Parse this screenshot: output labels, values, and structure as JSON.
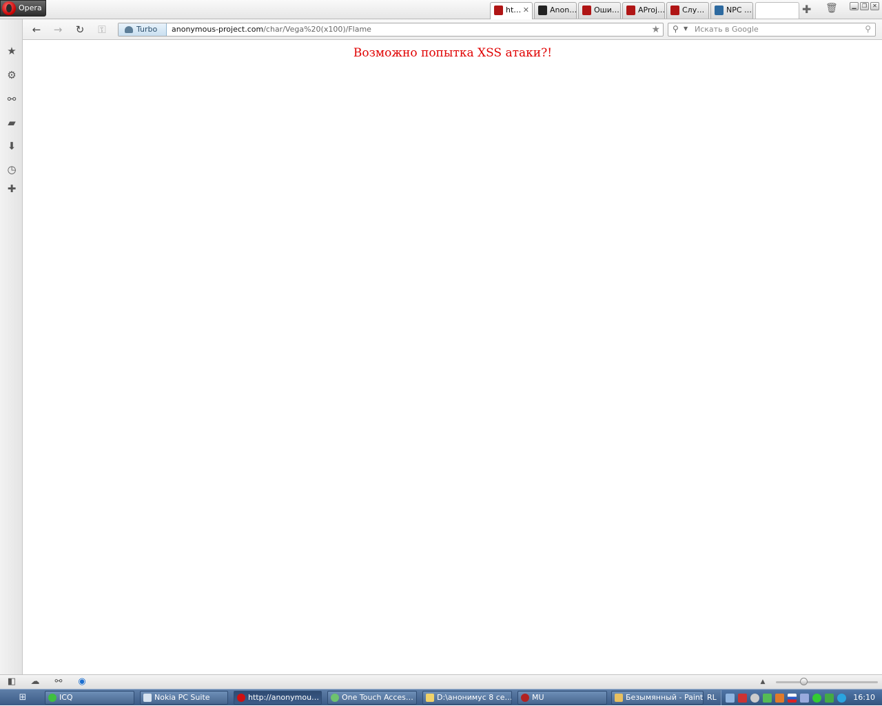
{
  "browser": {
    "menu_label": "Opera",
    "tabs": [
      {
        "title": "ht…",
        "icon": "opera-favicon",
        "active": true,
        "close": "✕"
      },
      {
        "title": "Anon…",
        "icon": "anonymous-favicon"
      },
      {
        "title": "Оши…",
        "icon": "opera-favicon"
      },
      {
        "title": "AProj…",
        "icon": "opera-favicon"
      },
      {
        "title": "Слу…",
        "icon": "opera-favicon"
      },
      {
        "title": "NPC …",
        "icon": "npc-favicon"
      }
    ]
  },
  "navbar": {
    "turbo_label": "Turbo",
    "url_host": "anonymous-project.com",
    "url_path": "/char/Vega%20(x100)/Flame",
    "search_placeholder": "Искать в Google"
  },
  "page": {
    "warning": "Возможно попытка XSS атаки?!",
    "warning_color": "#e00000"
  },
  "taskbar": {
    "items": [
      {
        "label": "ICQ",
        "icon": "icq-icon"
      },
      {
        "label": "Nokia PC Suite",
        "icon": "nokia-icon"
      },
      {
        "label": "http://anonymou…",
        "icon": "opera-icon",
        "active": true
      },
      {
        "label": "One Touch Acces…",
        "icon": "onetouch-icon"
      },
      {
        "label": "D:\\анонимус 8 се…",
        "icon": "folder-icon"
      },
      {
        "label": "MU",
        "icon": "mu-icon"
      },
      {
        "label": "Безымянный - Paint",
        "icon": "paint-icon"
      }
    ],
    "language": "RL",
    "clock": "16:10"
  }
}
